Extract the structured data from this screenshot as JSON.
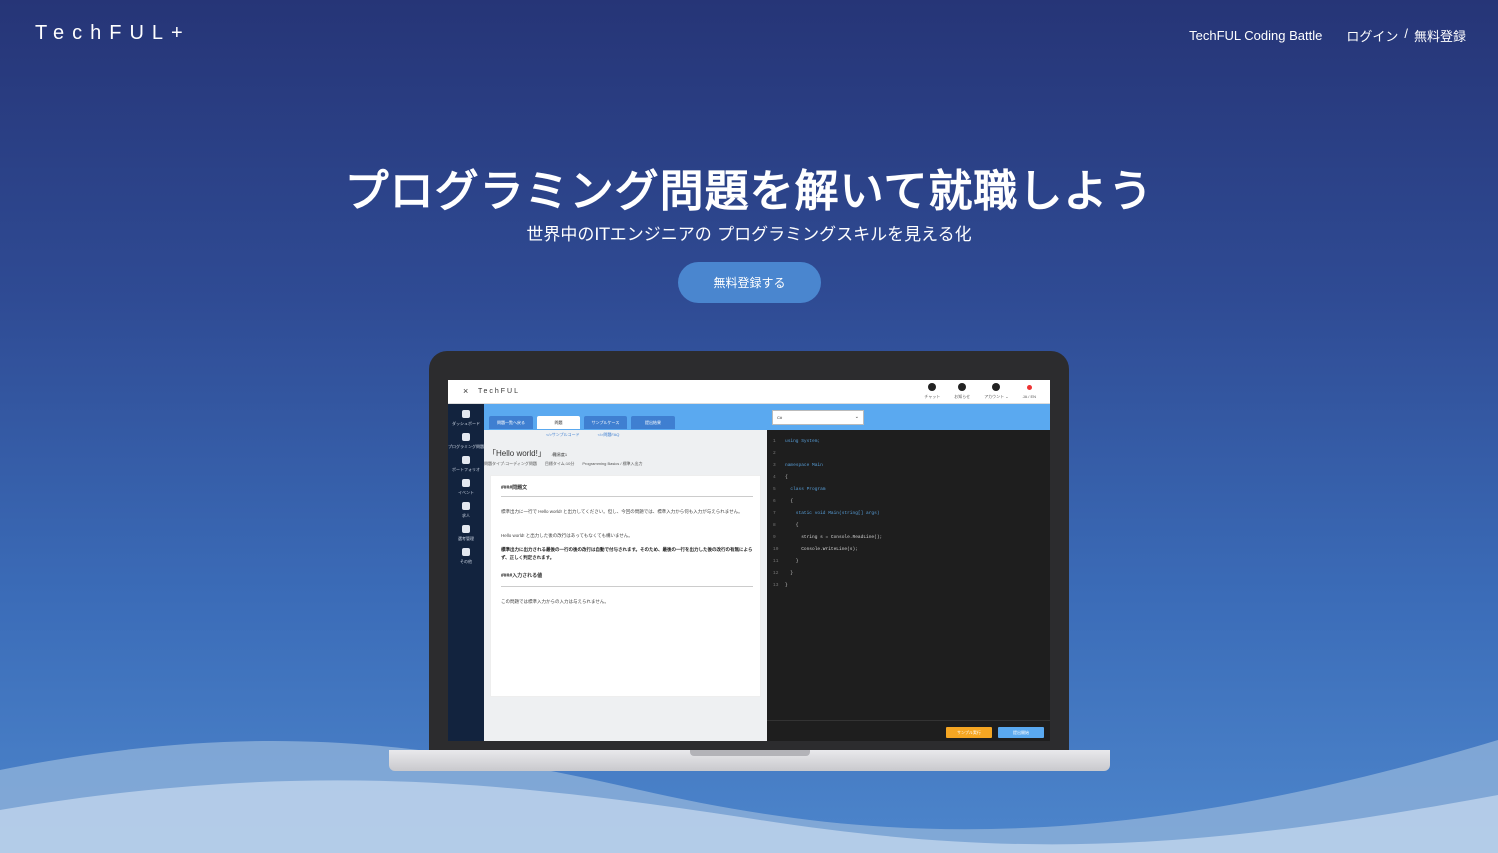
{
  "header": {
    "logo": "TechFUL",
    "nav_battle": "TechFUL Coding Battle",
    "nav_login": "ログイン",
    "nav_sep": "/",
    "nav_register": "無料登録"
  },
  "hero": {
    "title": "プログラミング問題を解いて就職しよう",
    "subtitle": "世界中のITエンジニアの プログラミングスキルを見える化",
    "cta": "無料登録する"
  },
  "app": {
    "brand": "TechFUL",
    "close": "×",
    "header_icons": [
      {
        "icon": "chat-icon",
        "label": "チャット"
      },
      {
        "icon": "bell-icon",
        "label": "お知らせ"
      },
      {
        "icon": "account-icon",
        "label": "アカウント ⌄"
      },
      {
        "icon": "language-dot-icon",
        "label": "JA / EN"
      }
    ],
    "sidebar": [
      {
        "icon": "dashboard-icon",
        "label": "ダッシュボード"
      },
      {
        "icon": "programming-problems-icon",
        "label": "プログラミング問題"
      },
      {
        "icon": "portfolio-icon",
        "label": "ポートフォリオ"
      },
      {
        "icon": "event-icon",
        "label": "イベント"
      },
      {
        "icon": "job-icon",
        "label": "求人"
      },
      {
        "icon": "application-icon",
        "label": "選考管理"
      },
      {
        "icon": "info-icon",
        "label": "その他"
      }
    ],
    "tabs": [
      "問題一覧へ戻る",
      "問題",
      "サンプルケース",
      "提出結果"
    ],
    "language": "C#",
    "sublinks": [
      "</>サンプルコード",
      "</>問題FAQ"
    ],
    "problem": {
      "title": "「Hello world!」",
      "level": "/難易度1",
      "meta": [
        "問題タイプ:コーディング問題",
        "目標タイム:10分",
        "Programming Basics / 標準入出力"
      ],
      "h1": "####問題文",
      "p1": "標準出力に一行で Hello world! と出力してください。但し、今回の問題では、標準入力から何も入力が与えられません。",
      "p2": "Hello world! と出力した後の改行はあってもなくても構いません。",
      "p3": "標準出力に出力される最後の一行の後の改行は自動で付与されます。そのため、最後の一行を出力した後の改行の有無によらず、正しく判定されます。",
      "h2": "####入力される値",
      "p4": "この問題では標準入力からの入力は与えられません。"
    },
    "code_lines": [
      "using System;",
      "",
      "namespace Main",
      "{",
      "  class Program",
      "  {",
      "    static void Main(string[] args)",
      "    {",
      "      string s = Console.ReadLine();",
      "      Console.WriteLine(s);",
      "    }",
      "  }",
      "}"
    ],
    "line_numbers": [
      "1",
      "2",
      "3",
      "4",
      "5",
      "6",
      "7",
      "8",
      "9",
      "10",
      "11",
      "12",
      "13"
    ],
    "run_button": "サンプル実行",
    "submit_button": "提出開始"
  }
}
